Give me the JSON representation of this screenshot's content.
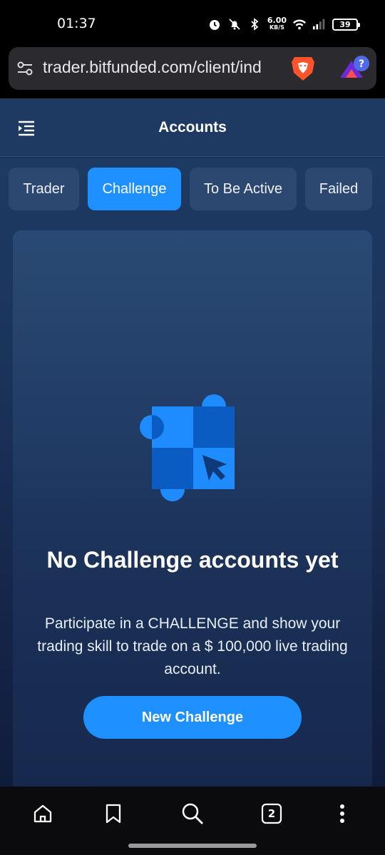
{
  "status_bar": {
    "time": "01:37",
    "net_speed_value": "6.00",
    "net_speed_unit": "KB/S",
    "battery": "39"
  },
  "browser": {
    "url": "trader.bitfunded.com/client/ind"
  },
  "header": {
    "title": "Accounts"
  },
  "tabs": [
    {
      "label": "Trader",
      "active": false
    },
    {
      "label": "Challenge",
      "active": true
    },
    {
      "label": "To Be Active",
      "active": false
    },
    {
      "label": "Failed",
      "active": false
    }
  ],
  "empty_state": {
    "title": "No Challenge accounts yet",
    "desc_line1": "Participate in a CHALLENGE and show your",
    "desc_line2": "trading skill to trade on a $ 100,000 live trading",
    "desc_line3": "account.",
    "button_label": "New Challenge"
  },
  "bottom_nav": {
    "tab_count": "2"
  },
  "colors": {
    "accent": "#1e90ff",
    "tab_inactive": "#2c4770",
    "header_bg": "#1f3a62",
    "illustration_light": "#1e8cff",
    "illustration_dark": "#0a5cc2"
  }
}
